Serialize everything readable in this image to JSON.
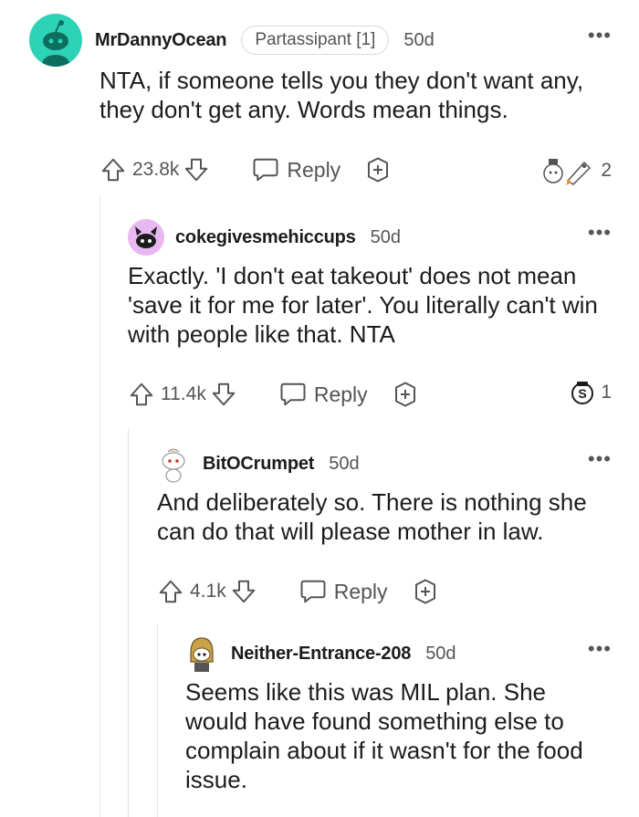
{
  "comments": [
    {
      "username": "MrDannyOcean",
      "flair": "Partassipant [1]",
      "age": "50d",
      "body": "NTA, if someone tells you they don't want any, they don't get any. Words mean things.",
      "votes": "23.8k",
      "reply_label": "Reply",
      "award_count": "2",
      "avatar_color": "#2ed3b7"
    },
    {
      "username": "cokegivesmehiccups",
      "age": "50d",
      "body": "Exactly. 'I don't eat takeout' does not mean 'save it for me for later'. You literally can't win with people like that. NTA",
      "votes": "11.4k",
      "reply_label": "Reply",
      "award_count": "1",
      "avatar_color": "#e9b8f2"
    },
    {
      "username": "BitOCrumpet",
      "age": "50d",
      "body": "And deliberately so. There is nothing she can do that will please mother in law.",
      "votes": "4.1k",
      "reply_label": "Reply"
    },
    {
      "username": "Neither-Entrance-208",
      "age": "50d",
      "body": "Seems like this was MIL plan. She would have found something else to complain about if it wasn't for the food issue."
    }
  ],
  "more_label": "•••",
  "colors": {
    "text": "#1c1c1c",
    "muted": "#555555",
    "line": "#e4e4e4"
  }
}
